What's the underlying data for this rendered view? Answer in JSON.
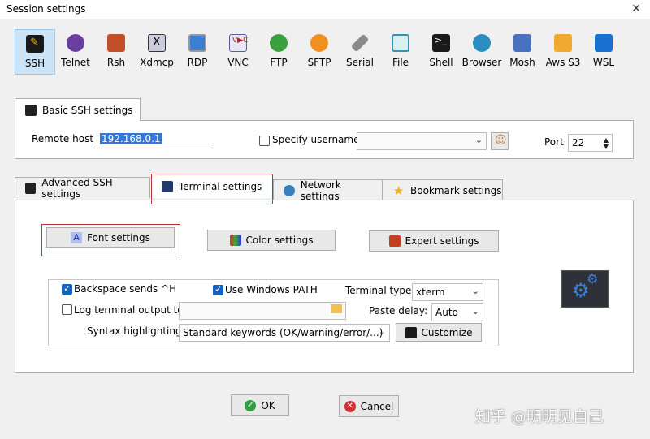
{
  "window": {
    "title": "Session settings"
  },
  "session_types": [
    {
      "label": "SSH",
      "icon": "ssh-icon",
      "selected": true
    },
    {
      "label": "Telnet",
      "icon": "telnet-icon"
    },
    {
      "label": "Rsh",
      "icon": "rsh-icon"
    },
    {
      "label": "Xdmcp",
      "icon": "xdmcp-icon"
    },
    {
      "label": "RDP",
      "icon": "rdp-icon"
    },
    {
      "label": "VNC",
      "icon": "vnc-icon"
    },
    {
      "label": "FTP",
      "icon": "ftp-icon"
    },
    {
      "label": "SFTP",
      "icon": "sftp-icon"
    },
    {
      "label": "Serial",
      "icon": "serial-icon"
    },
    {
      "label": "File",
      "icon": "file-icon"
    },
    {
      "label": "Shell",
      "icon": "shell-icon"
    },
    {
      "label": "Browser",
      "icon": "browser-icon"
    },
    {
      "label": "Mosh",
      "icon": "mosh-icon"
    },
    {
      "label": "Aws S3",
      "icon": "aws-s3-icon"
    },
    {
      "label": "WSL",
      "icon": "wsl-icon"
    }
  ],
  "basic": {
    "tab_label": "Basic SSH settings",
    "remote_host_label": "Remote host *",
    "remote_host_value": "192.168.0.1",
    "specify_username_label": "Specify username",
    "port_label": "Port",
    "port_value": "22"
  },
  "tabs": [
    {
      "label": "Advanced SSH settings",
      "icon": "wrench-icon"
    },
    {
      "label": "Terminal settings",
      "icon": "terminal-icon",
      "active": true
    },
    {
      "label": "Network settings",
      "icon": "network-icon"
    },
    {
      "label": "Bookmark settings",
      "icon": "star-icon"
    }
  ],
  "terminal": {
    "font_button": "Font settings",
    "color_button": "Color settings",
    "expert_button": "Expert settings",
    "backspace_label": "Backspace sends ^H",
    "windows_path_label": "Use Windows PATH",
    "terminal_type_label": "Terminal type:",
    "terminal_type_value": "xterm",
    "log_output_label": "Log terminal output to:",
    "paste_delay_label": "Paste delay:",
    "paste_delay_value": "Auto",
    "syntax_label": "Syntax highlighting:",
    "syntax_value": "Standard keywords (OK/warning/error/...)",
    "customize_button": "Customize"
  },
  "footer": {
    "ok": "OK",
    "cancel": "Cancel"
  },
  "watermark": "知乎 @明明见自己",
  "colors": {
    "selected_bg": "#cce4f7",
    "accent": "#1660c0",
    "red_frame": "#b3363a"
  }
}
